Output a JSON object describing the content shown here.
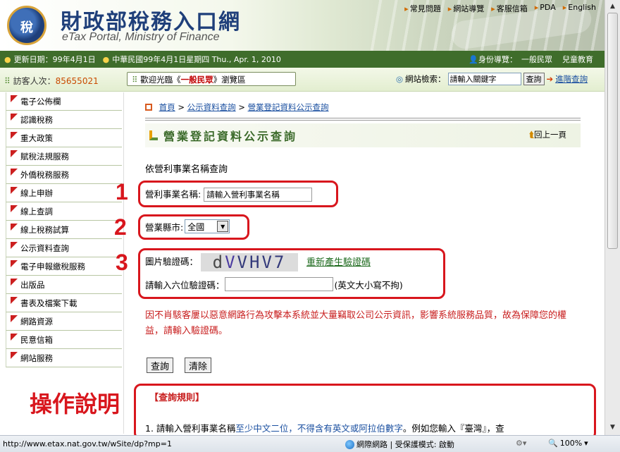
{
  "header": {
    "seal_glyph": "稅",
    "logo_title": "財政部稅務入口網",
    "logo_subtitle": "eTax Portal, Ministry of Finance",
    "top_links": [
      "常見問題",
      "網站導覽",
      "客服信箱",
      "PDA",
      "English"
    ]
  },
  "datebar": {
    "update_date": "更新日期：99年4月1日",
    "today": "中華民國99年4月1日星期四 Thu., Apr. 1, 2010",
    "identity_label": "身份導覽：",
    "identity_public": "一般民眾",
    "identity_kids": "兒童教育"
  },
  "visitbar": {
    "visitor_label": "訪客人次：",
    "visitor_count": "85655021",
    "welcome_prefix": "歡迎光臨《",
    "welcome_role": "一般民眾",
    "welcome_suffix": "》瀏覽區",
    "search_label": "網站檢索：",
    "search_value": "請輸入關鍵字",
    "search_button": "查詢",
    "advanced_search": "進階查詢"
  },
  "sidebar": {
    "items": [
      "電子公佈欄",
      "認識稅務",
      "重大政策",
      "賦稅法規服務",
      "外僑稅務服務",
      "線上申辦",
      "線上查調",
      "線上稅務試算",
      "公示資料查詢",
      "電子申報繳稅服務",
      "出版品",
      "書表及檔案下載",
      "網路資源",
      "民意信箱",
      "網站服務"
    ]
  },
  "breadcrumb": {
    "home": "首頁",
    "sep": ">",
    "level1": "公示資料查詢",
    "level2": "營業登記資料公示查詢"
  },
  "page": {
    "title": "營業登記資料公示查詢",
    "back": "回上一頁",
    "subheading": "依營利事業名稱查詢"
  },
  "form": {
    "name_label": "營利事業名稱:",
    "name_value": "請輸入營利事業名稱",
    "county_label": "營業縣市:",
    "county_selected": "全國",
    "captcha_label": "圖片驗證碼：",
    "captcha_text": [
      "d",
      "V",
      "VHV7"
    ],
    "regenerate": "重新產生驗證碼",
    "captcha_input_label": "請輸入六位驗證碼：",
    "captcha_input_value": "",
    "captcha_hint": "(英文大小寫不拘)",
    "warning": "因不肖駭客屢以惡意網路行為攻擊本系統並大量竊取公司公示資訊，影響系統服務品質，故為保障您的權益，請輸入驗證碼。",
    "query_button": "查詢",
    "clear_button": "清除"
  },
  "annotations": {
    "n1": "1",
    "n2": "2",
    "n3": "3",
    "instructions": "操作說明"
  },
  "rules": {
    "title": "【查詢規則】",
    "line1_a": "1. 請輸入營利事業名稱",
    "line1_b": "至少中文二位，不得含有英文或阿拉伯數字",
    "line1_c": "。例如您輸入『臺灣』，查"
  },
  "statusbar": {
    "url": "http://www.etax.nat.gov.tw/wSite/dp?mp=1",
    "zone": "網際網路 | 受保護模式: 啟動",
    "zoom": "100%"
  },
  "colors": {
    "header_green": "#3f6d2b",
    "annotation_red": "#d8161d",
    "link_blue": "#1a4fa0",
    "warning_red": "#c81e1e"
  }
}
